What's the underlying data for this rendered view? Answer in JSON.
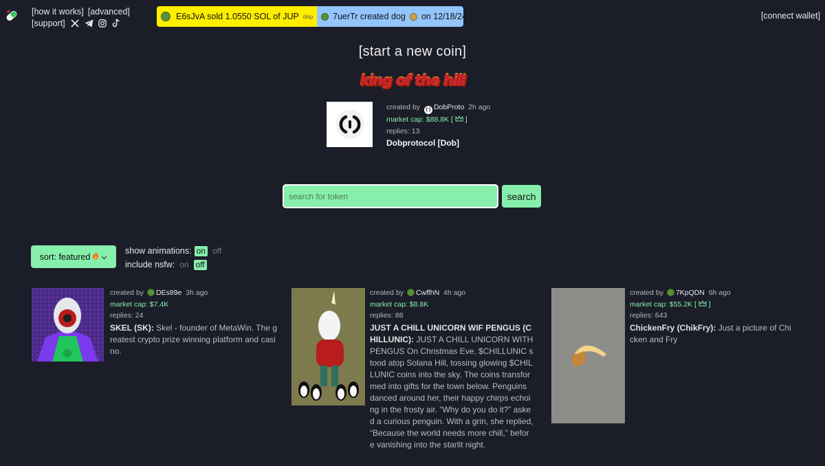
{
  "nav": {
    "how_it_works": "[how it works]",
    "advanced": "[advanced]",
    "support": "[support]",
    "connect_wallet": "[connect wallet]"
  },
  "ticker": {
    "trade_text": "E6sJvA  sold 1.0550 SOL of JUP",
    "disp_text": "disp",
    "create_text": "7uerTr created dog",
    "create_date": "on 12/18/24"
  },
  "start_coin": "[start a new coin]",
  "king_of_the_hill": {
    "banner": "king of the hill",
    "created_by_label": "created by",
    "creator": "DobProto",
    "age": "2h ago",
    "market_cap": "market cap: $88.8K [",
    "market_cap_suffix": "]",
    "replies": "replies: 13",
    "name": "Dobprotocol [Dob]"
  },
  "search": {
    "placeholder": "search for token",
    "button": "search"
  },
  "controls": {
    "sort_label": "sort: featured",
    "show_animations": "show animations:",
    "include_nsfw": "include nsfw:",
    "on": "on",
    "off": "off"
  },
  "cards": [
    {
      "created_by_label": "created by",
      "creator": "DEs89e",
      "age": "3h ago",
      "market_cap": "market cap: $7.4K",
      "replies": "replies: 24",
      "title": "SKEL (SK):",
      "desc": "Skel - founder of MetaWin. The greatest crypto prize winning platform and casino."
    },
    {
      "created_by_label": "created by",
      "creator": "CwffhN",
      "age": "4h ago",
      "market_cap": "market cap: $8.8K",
      "replies": "replies: 88",
      "title": "JUST A CHILL UNICORN WIF PENGUS (CHILLUNIC):",
      "desc": "JUST A CHILL UNICORN WITH PENGUS On Christmas Eve, $CHILLUNIC stood atop Solana Hill, tossing glowing $CHILLUNIC coins into the sky. The coins transformed into gifts for the town below. Penguins danced around her, their happy chirps echoing in the frosty air. “Why do you do it?” asked a curious penguin. With a grin, she replied, “Because the world needs more chill,” before vanishing into the starlit night."
    },
    {
      "created_by_label": "created by",
      "creator": "7KpQDN",
      "age": "6h ago",
      "market_cap": "market cap: $55.2K [",
      "market_cap_suffix": "]",
      "replies": "replies: 643",
      "title": "ChickenFry (ChikFry):",
      "desc": "Just a picture of Chicken and Fry"
    }
  ],
  "colors": {
    "background": "#1b1d28",
    "accent_green": "#86efac",
    "ticker_yellow": "#ffee00",
    "ticker_blue": "#93c5fd"
  }
}
